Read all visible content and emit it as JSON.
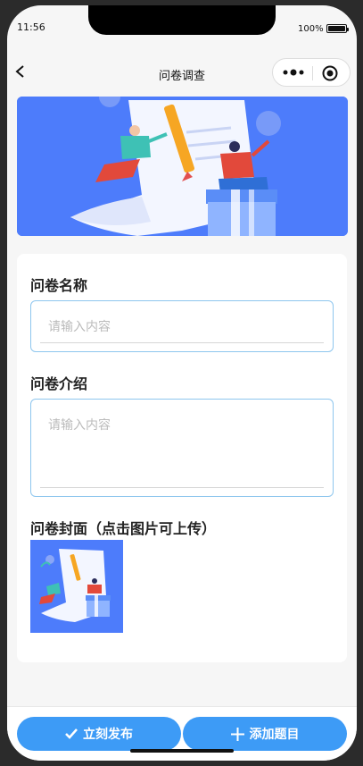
{
  "status_bar": {
    "time": "11:56",
    "battery": "100%"
  },
  "nav": {
    "title": "问卷调查",
    "back_icon": "chevron-left-icon",
    "more_icon": "more-dots-icon",
    "close_icon": "target-icon"
  },
  "banner": {
    "illustration": "survey-illustration"
  },
  "form": {
    "name_label": "问卷名称",
    "name_placeholder": "请输入内容",
    "name_value": "",
    "intro_label": "问卷介绍",
    "intro_placeholder": "请输入内容",
    "intro_value": "",
    "cover_label": "问卷封面（点击图片可上传）"
  },
  "actions": {
    "publish_label": "立刻发布",
    "publish_icon": "check-icon",
    "add_label": "添加题目",
    "add_icon": "plus-icon"
  },
  "colors": {
    "accent": "#3d9bf6",
    "banner_bg": "#4d7cfb",
    "field_border": "#8ec6ee"
  }
}
